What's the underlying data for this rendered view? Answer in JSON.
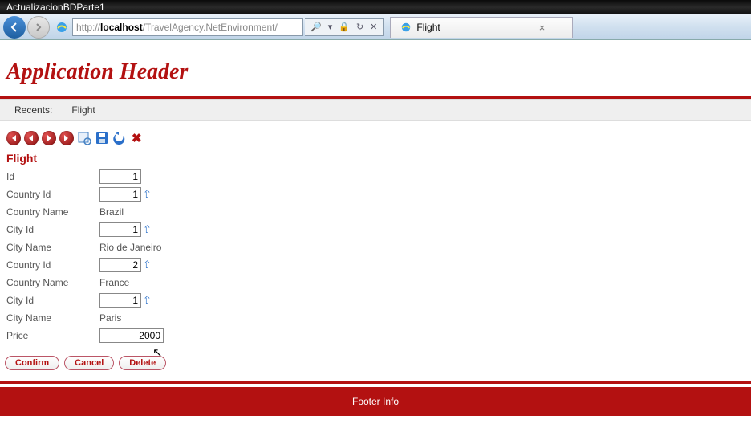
{
  "window": {
    "title": "ActualizacionBDParte1"
  },
  "browser": {
    "url_prefix": "http://",
    "url_host": "localhost",
    "url_path": "/TravelAgency.NetEnvironment/",
    "tab_title": "Flight"
  },
  "header": {
    "title": "Application Header"
  },
  "recents": {
    "label": "Recents:",
    "item": "Flight"
  },
  "toolbar": {
    "first": "❘◀",
    "prev": "◀",
    "next": "▶",
    "last": "▶❘",
    "select": "select",
    "save": "save",
    "undo": "undo",
    "delete": "✖"
  },
  "form": {
    "title": "Flight",
    "labels": {
      "id": "Id",
      "country_id": "Country Id",
      "country_name": "Country Name",
      "city_id": "City Id",
      "city_name": "City Name",
      "price": "Price"
    },
    "values": {
      "id": "1",
      "country_id_1": "1",
      "country_name_1": "Brazil",
      "city_id_1": "1",
      "city_name_1": "Rio de Janeiro",
      "country_id_2": "2",
      "country_name_2": "France",
      "city_id_2": "1",
      "city_name_2": "Paris",
      "price": "2000"
    }
  },
  "buttons": {
    "confirm": "Confirm",
    "cancel": "Cancel",
    "delete": "Delete"
  },
  "footer": {
    "text": "Footer Info"
  }
}
